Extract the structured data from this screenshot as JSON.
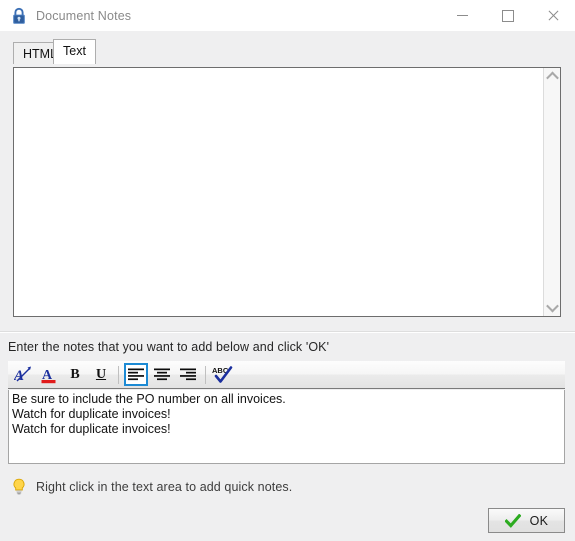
{
  "window": {
    "title": "Document Notes",
    "icon": "padlock-icon",
    "controls": {
      "minimize": "minimize-icon",
      "maximize": "maximize-icon",
      "close": "close-icon"
    }
  },
  "tabs": [
    {
      "id": "html",
      "label": "HTML",
      "selected": false
    },
    {
      "id": "text",
      "label": "Text",
      "selected": true
    }
  ],
  "preview": {
    "content": "",
    "scrollbar": {
      "up_arrow": "chevron-up-icon",
      "down_arrow": "chevron-down-icon"
    }
  },
  "instruction": "Enter the notes that you want to add below and click 'OK'",
  "toolbar": {
    "buttons": [
      {
        "id": "font",
        "name": "font-icon",
        "tooltip": "Font",
        "active": false
      },
      {
        "id": "font-color",
        "name": "font-color-icon",
        "tooltip": "Font Color",
        "active": false
      },
      {
        "id": "bold",
        "name": "bold-icon",
        "label": "B",
        "tooltip": "Bold",
        "active": false
      },
      {
        "id": "underline",
        "name": "underline-icon",
        "label": "U",
        "tooltip": "Underline",
        "active": false
      },
      {
        "id": "align-left",
        "name": "align-left-icon",
        "tooltip": "Align Left",
        "active": true
      },
      {
        "id": "align-center",
        "name": "align-center-icon",
        "tooltip": "Align Center",
        "active": false
      },
      {
        "id": "align-right",
        "name": "align-right-icon",
        "tooltip": "Align Right",
        "active": false
      },
      {
        "id": "spell-check",
        "name": "spell-check-icon",
        "label": "ABC",
        "tooltip": "Spell Check",
        "active": false
      }
    ]
  },
  "notes": {
    "lines": [
      "Be sure to include the PO number on all invoices.",
      "Watch for duplicate invoices!",
      "Watch for duplicate invoices!"
    ]
  },
  "hint": {
    "icon": "lightbulb-icon",
    "text": "Right click in the text area to add quick notes."
  },
  "footer": {
    "ok_label": "OK",
    "ok_icon": "green-check-icon"
  },
  "colors": {
    "window_bg": "#efeff0",
    "titlebar_bg": "#ffffff",
    "accent_blue": "#1c8ad4",
    "icon_blue": "#2244aa",
    "red_bar": "#e01b1b",
    "green_check": "#2cab20",
    "bulb_yellow": "#ffd54a"
  }
}
